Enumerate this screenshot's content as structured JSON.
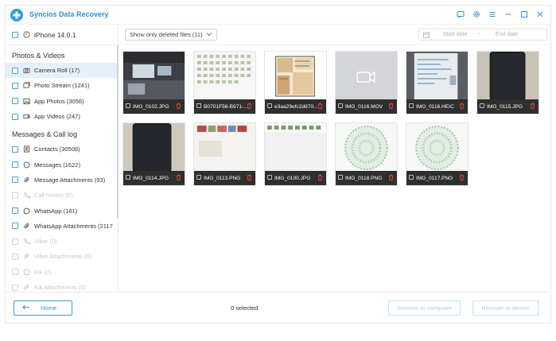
{
  "app": {
    "title": "Syncios Data Recovery",
    "accent": "#2e8fdb"
  },
  "window_controls": [
    "feedback-icon",
    "settings-icon",
    "menu-icon",
    "minimize-icon",
    "maximize-icon",
    "close-icon"
  ],
  "device": {
    "name": "iPhone 14.0.1"
  },
  "sidebar": {
    "sections": [
      {
        "title": "Photos & Videos",
        "items": [
          {
            "label": "Camera Roll (17)",
            "icon": "camera-icon",
            "active": true
          },
          {
            "label": "Photo Stream (1241)",
            "icon": "photo-stream-icon"
          },
          {
            "label": "App Photos (3056)",
            "icon": "image-icon"
          },
          {
            "label": "App Videos (247)",
            "icon": "video-icon"
          }
        ]
      },
      {
        "title": "Messages & Call log",
        "items": [
          {
            "label": "Contacts (30508)",
            "icon": "contacts-icon"
          },
          {
            "label": "Messages (1622)",
            "icon": "message-icon"
          },
          {
            "label": "Message Attachments (93)",
            "icon": "attachment-icon"
          },
          {
            "label": "Call history (0)",
            "icon": "phone-icon",
            "disabled": true
          },
          {
            "label": "WhatsApp (161)",
            "icon": "whatsapp-icon"
          },
          {
            "label": "WhatsApp Attachments (2117",
            "icon": "attachment-icon"
          },
          {
            "label": "Viber (0)",
            "icon": "viber-icon",
            "disabled": true
          },
          {
            "label": "Viber Attachments (0)",
            "icon": "attachment-icon",
            "disabled": true
          },
          {
            "label": "Kik (0)",
            "icon": "kik-icon",
            "disabled": true
          },
          {
            "label": "Kik Attachments (0)",
            "icon": "attachment-icon",
            "disabled": true
          }
        ]
      }
    ]
  },
  "toolbar": {
    "filter_label": "Show only deleted files (11)",
    "start_date_placeholder": "Start date",
    "date_separator": "-",
    "end_date_placeholder": "End date"
  },
  "files": [
    {
      "name": "IMG_0102.JPG",
      "kind": "office"
    },
    {
      "name": "B0701F56-B971-...",
      "kind": "screenshot"
    },
    {
      "name": "e3aa29efc2d970...",
      "kind": "floorplan"
    },
    {
      "name": "IMG_0116.MOV",
      "kind": "video"
    },
    {
      "name": "IMG_0116.HEIC",
      "kind": "whiteboard"
    },
    {
      "name": "IMG_0115.JPG",
      "kind": "phone"
    },
    {
      "name": "IMG_0114.JPG",
      "kind": "phone"
    },
    {
      "name": "IMG_0113.PNG",
      "kind": "wall"
    },
    {
      "name": "IMG_0100.JPG",
      "kind": "screen"
    },
    {
      "name": "IMG_0118.PNG",
      "kind": "qr"
    },
    {
      "name": "IMG_0117.PNG",
      "kind": "qr"
    }
  ],
  "footer": {
    "home_label": "Home",
    "selected_text": "0 selected",
    "recover_computer_label": "Recover to computer",
    "recover_device_label": "Recover to device"
  }
}
